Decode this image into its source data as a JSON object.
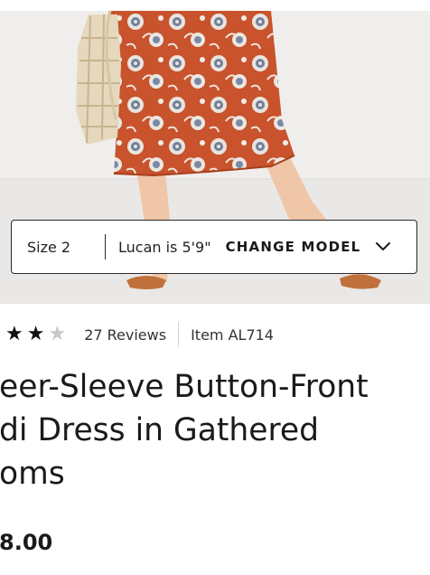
{
  "product": {
    "model_size": "Size 2",
    "model_height": "Lucan is 5'9\"",
    "change_model_label": "CHANGE MODEL",
    "rating": 2,
    "rating_max": 3,
    "reviews_label": "27 Reviews",
    "item_label": "Item AL714",
    "title": "eer-Sleeve Button-Front\ndi Dress in Gathered\noms",
    "price": "8.00"
  },
  "icons": {
    "model_dropdown": "chevron-down-icon",
    "star_filled": "star-filled-icon",
    "star_empty": "star-empty-icon"
  },
  "colors": {
    "dress": "#c8532c",
    "text": "#1a1a1a",
    "star_on": "#111111",
    "star_off": "#c8c8c8"
  }
}
